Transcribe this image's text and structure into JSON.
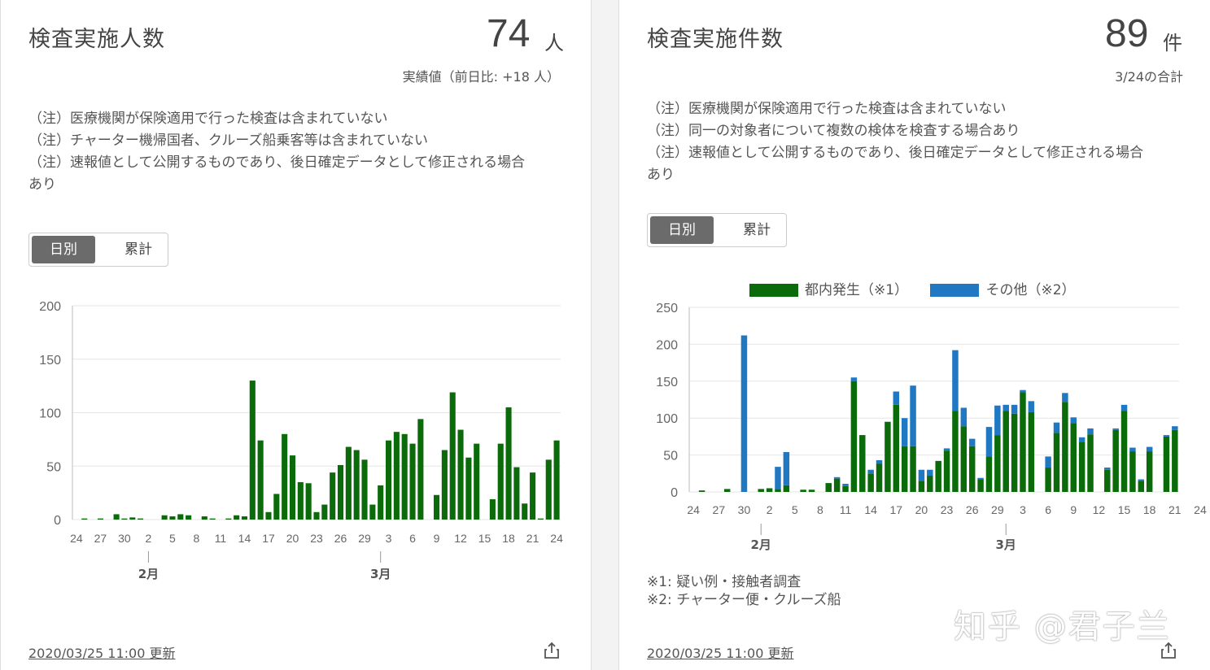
{
  "card1": {
    "title": "検査実施人数",
    "value": "74",
    "unit": "人",
    "sub": "実績値（前日比: +18 人）",
    "notes": [
      "（注）医療機関が保険適用で行った検査は含まれていない",
      "（注）チャーター機帰国者、クルーズ船乗客等は含まれていない",
      "（注）速報値として公開するものであり、後日確定データとして修正される場合",
      "あり"
    ],
    "toggle": {
      "daily": "日別",
      "cumulative": "累計"
    },
    "updated": "2020/03/25 11:00 更新"
  },
  "card2": {
    "title": "検査実施件数",
    "value": "89",
    "unit": "件",
    "sub": "3/24の合計",
    "notes": [
      "（注）医療機関が保険適用で行った検査は含まれていない",
      "（注）同一の対象者について複数の検体を検査する場合あり",
      "（注）速報値として公開するものであり、後日確定データとして修正される場合",
      "あり"
    ],
    "toggle": {
      "daily": "日別",
      "cumulative": "累計"
    },
    "footnotes": [
      "※1: 疑い例・接触者調査",
      "※2: チャーター便・クルーズ船"
    ],
    "updated": "2020/03/25 11:00 更新"
  },
  "watermark": "知乎 @君子兰",
  "colors": {
    "green": "#0b6b0b",
    "blue": "#1f78c1",
    "grid": "#e6e6e6",
    "axis": "#bbbbbb"
  },
  "icons": {
    "share": "share-icon"
  },
  "chart_data": [
    {
      "type": "bar",
      "title": "",
      "ylim": [
        0,
        200
      ],
      "yticks": [
        0,
        50,
        100,
        150,
        200
      ],
      "xtick_labels": [
        "24",
        "27",
        "30",
        "2",
        "5",
        "8",
        "11",
        "14",
        "17",
        "20",
        "23",
        "26",
        "29",
        "3",
        "6",
        "9",
        "12",
        "15",
        "18",
        "21",
        "24"
      ],
      "month_labels": [
        {
          "label": "2月",
          "at_index": 9
        },
        {
          "label": "3月",
          "at_index": 38
        }
      ],
      "series": [
        {
          "values": [
            0,
            1,
            0,
            1,
            0,
            5,
            1,
            2,
            1,
            0,
            0,
            4,
            3,
            5,
            4,
            0,
            3,
            1,
            0,
            1,
            4,
            3,
            130,
            74,
            7,
            24,
            80,
            60,
            35,
            34,
            7,
            14,
            44,
            51,
            68,
            65,
            56,
            14,
            32,
            74,
            82,
            80,
            71,
            94,
            0,
            23,
            65,
            119,
            84,
            58,
            71,
            0,
            19,
            71,
            105,
            49,
            15,
            44,
            1,
            56,
            74
          ]
        }
      ]
    },
    {
      "type": "bar",
      "title": "",
      "ylim": [
        0,
        250
      ],
      "yticks": [
        0,
        50,
        100,
        150,
        200,
        250
      ],
      "xtick_labels": [
        "24",
        "27",
        "30",
        "2",
        "5",
        "8",
        "11",
        "14",
        "17",
        "20",
        "23",
        "26",
        "29",
        "3",
        "6",
        "9",
        "12",
        "15",
        "18",
        "21",
        "24"
      ],
      "month_labels": [
        {
          "label": "2月",
          "at_index": 8
        },
        {
          "label": "3月",
          "at_index": 37
        }
      ],
      "legend": [
        "都内発生（※1）",
        "その他（※2）"
      ],
      "series": [
        {
          "name": "都内発生（※1）",
          "values": [
            0,
            2,
            0,
            0,
            4,
            0,
            0,
            0,
            4,
            5,
            4,
            9,
            0,
            3,
            3,
            0,
            12,
            18,
            8,
            150,
            77,
            25,
            38,
            95,
            118,
            62,
            62,
            15,
            22,
            42,
            56,
            110,
            89,
            62,
            17,
            48,
            77,
            110,
            106,
            135,
            108,
            0,
            33,
            80,
            122,
            93,
            68,
            78,
            0,
            30,
            84,
            110,
            55,
            15,
            55,
            0,
            75,
            84
          ]
        },
        {
          "name": "その他（※2）",
          "values": [
            0,
            0,
            0,
            0,
            0,
            0,
            212,
            0,
            0,
            0,
            30,
            45,
            0,
            0,
            0,
            0,
            0,
            2,
            3,
            5,
            0,
            5,
            5,
            0,
            18,
            38,
            82,
            15,
            8,
            0,
            3,
            82,
            25,
            10,
            2,
            40,
            40,
            8,
            12,
            3,
            15,
            0,
            15,
            14,
            12,
            8,
            6,
            8,
            0,
            3,
            2,
            8,
            5,
            2,
            6,
            0,
            2,
            5
          ]
        }
      ]
    }
  ]
}
